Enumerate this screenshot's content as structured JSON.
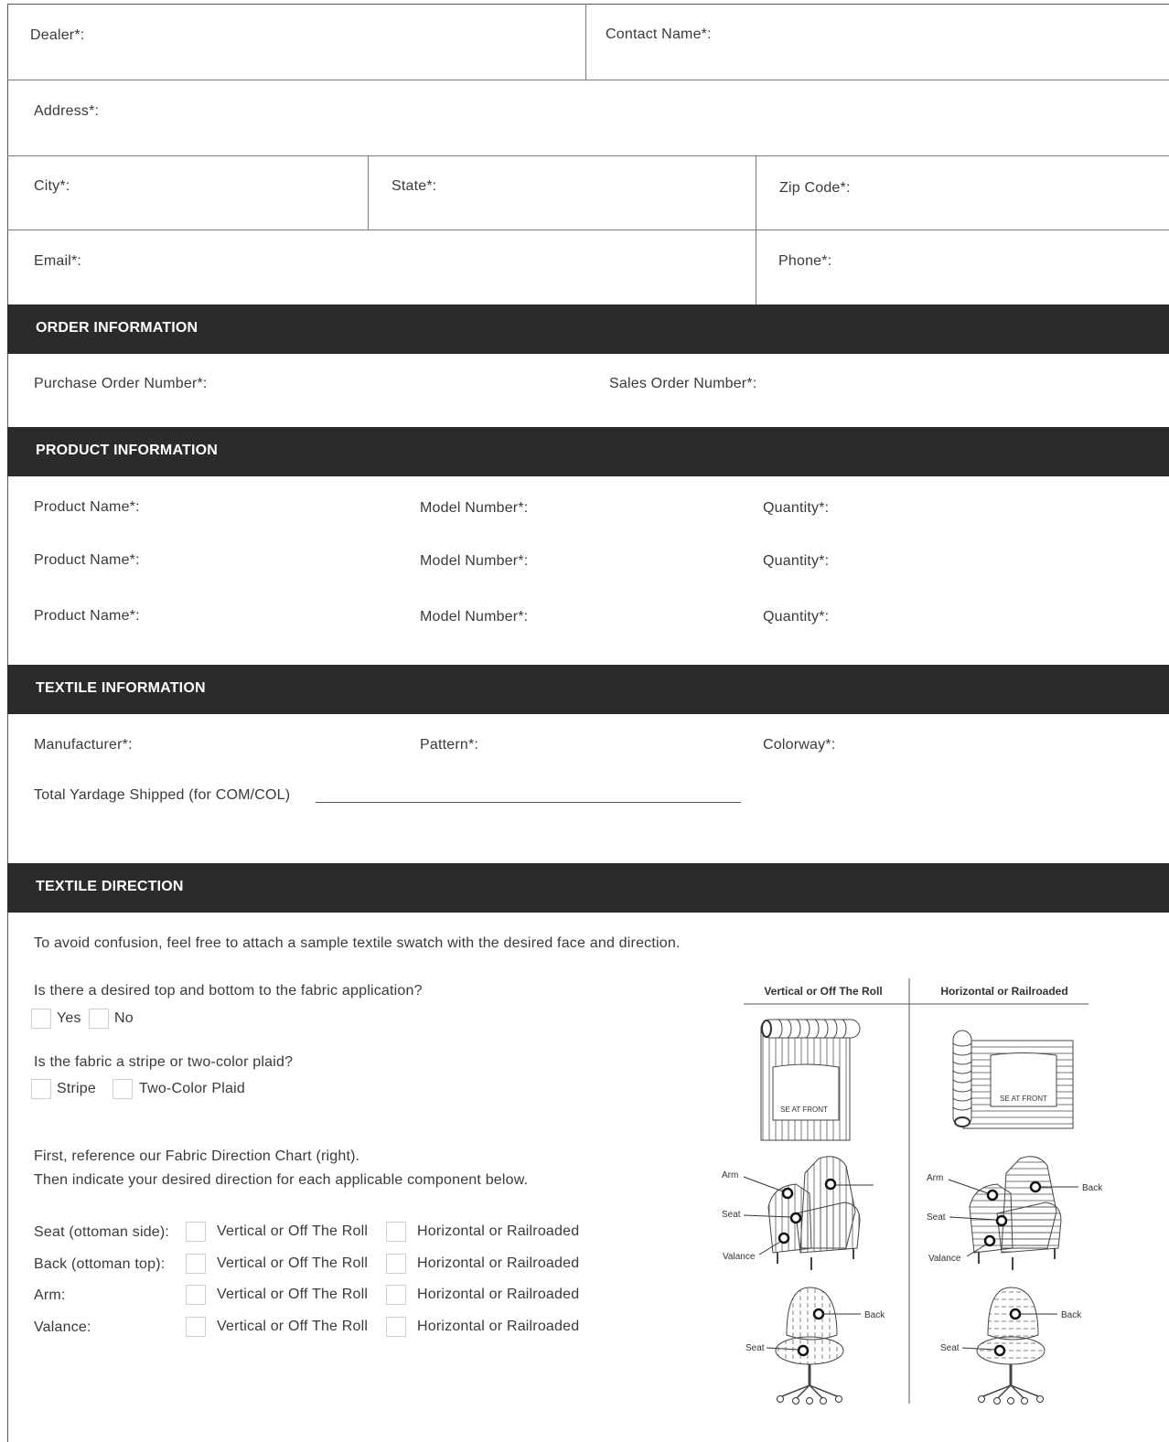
{
  "contact": {
    "dealer": "Dealer*:",
    "contact_name": "Contact Name*:",
    "address": "Address*:",
    "city": "City*:",
    "state": "State*:",
    "zip": "Zip Code*:",
    "email": "Email*:",
    "phone": "Phone*:"
  },
  "order": {
    "header": "ORDER INFORMATION",
    "po_number": "Purchase Order Number*:",
    "so_number": "Sales Order Number*:"
  },
  "product": {
    "header": "PRODUCT INFORMATION",
    "rows": [
      {
        "name": "Product Name*:",
        "model": "Model Number*:",
        "qty": "Quantity*:"
      },
      {
        "name": "Product Name*:",
        "model": "Model Number*:",
        "qty": "Quantity*:"
      },
      {
        "name": "Product Name*:",
        "model": "Model Number*:",
        "qty": "Quantity*:"
      }
    ]
  },
  "textile": {
    "header": "TEXTILE INFORMATION",
    "manufacturer": "Manufacturer*:",
    "pattern": "Pattern*:",
    "colorway": "Colorway*:",
    "yardage": "Total Yardage Shipped (for COM/COL)"
  },
  "direction": {
    "header": "TEXTILE DIRECTION",
    "intro": "To avoid confusion, feel free to attach a sample textile swatch with the desired face and direction.",
    "q1": "Is there a desired top and bottom to the fabric application?",
    "q1_yes": "Yes",
    "q1_no": "No",
    "q2": "Is the fabric a stripe or two-color plaid?",
    "q2_stripe": "Stripe",
    "q2_plaid": "Two-Color Plaid",
    "ref1": "First, reference our Fabric Direction Chart (right).",
    "ref2": "Then indicate your desired direction for each applicable component below.",
    "components": [
      {
        "label": "Seat (ottoman side):",
        "opt1": "Vertical or Off The Roll",
        "opt2": "Horizontal or Railroaded"
      },
      {
        "label": "Back (ottoman top):",
        "opt1": "Vertical or Off The Roll",
        "opt2": "Horizontal or Railroaded"
      },
      {
        "label": "Arm:",
        "opt1": "Vertical or Off The Roll",
        "opt2": "Horizontal or Railroaded"
      },
      {
        "label": "Valance:",
        "opt1": "Vertical or Off The Roll",
        "opt2": "Horizontal or Railroaded"
      }
    ],
    "chart": {
      "col1_title": "Vertical or Off The Roll",
      "col2_title": "Horizontal or Railroaded",
      "seat_front": "SE AT FRONT",
      "arm": "Arm",
      "seat": "Seat",
      "valance": "Valance",
      "back": "Back"
    }
  }
}
